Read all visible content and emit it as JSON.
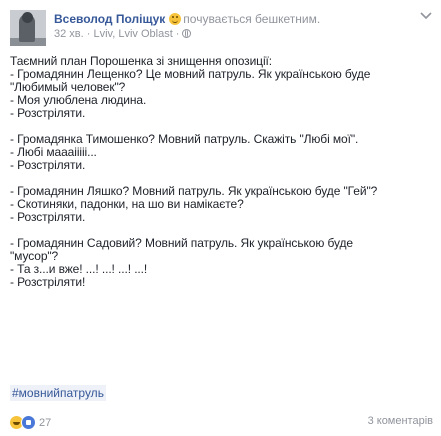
{
  "post": {
    "author": "Всеволод Поліщук",
    "feeling": "почувається бешкетним.",
    "time": "32 хв.",
    "location": "· Lviv, Lviv Oblast ·",
    "lines": [
      "Таємний план Порошенка зі знищення опозиції:",
      "- Громадянин Лещенко? Це мовний патруль. Як українською буде",
      "\"Любимый человек\"?",
      "- Моя улюблена людина.",
      "- Розстріляти.",
      "",
      "- Громадянка Тимошенко? Мовний патруль. Скажіть \"Любі мої\".",
      "- Любі маааііііі...",
      "- Розстріляти.",
      "",
      "- Громадянин Ляшко? Мовний патруль. Як українською буде \"Гей\"?",
      "- Скотиняки, падонки, на шо ви намікаєте?",
      "- Розстріляти.",
      "",
      "- Громадянин Садовий? Мовний патруль. Як українською буде",
      "\"мусор\"?",
      "- Та з...и вже! ...! ...! ...! ...!",
      "- Розстріляти!"
    ],
    "hashtag": "#мовнийпатруль",
    "reactions": {
      "icons": [
        "haha-icon",
        "like-icon"
      ],
      "count": "27"
    },
    "comments": "3 коментарів"
  }
}
